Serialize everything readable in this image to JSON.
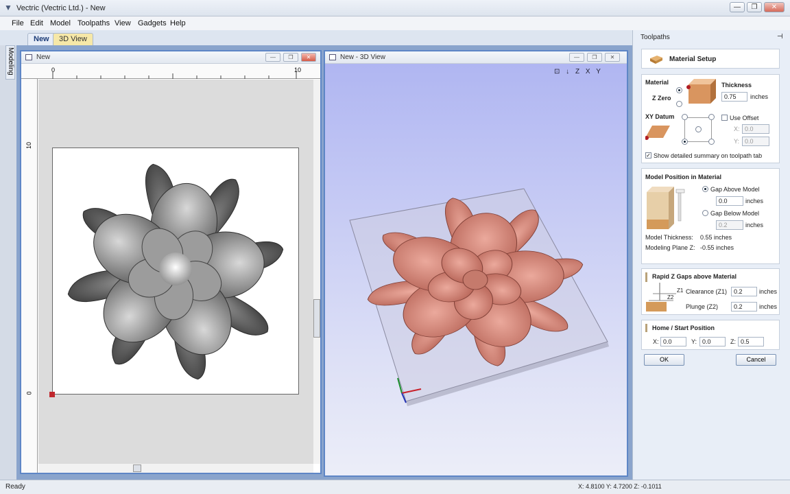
{
  "window": {
    "title": "Vectric (Vectric Ltd.) - New",
    "min": "—",
    "max": "❐",
    "close": "✕"
  },
  "menu": [
    "File",
    "Edit",
    "Model",
    "Toolpaths",
    "View",
    "Gadgets",
    "Help"
  ],
  "tabs": {
    "new": "New",
    "view3d": "3D View",
    "modeling": "Modeling"
  },
  "view2d": {
    "title": "New",
    "ruler_top": [
      "0",
      "10"
    ],
    "ruler_left": [
      "10",
      "0"
    ]
  },
  "view3d": {
    "title": "New - 3D View",
    "view_icons": [
      "⊡",
      "↓",
      "Z",
      "X",
      "Y"
    ]
  },
  "panel": {
    "header": "Toolpaths",
    "pin": "⊣",
    "setup_title": "Material Setup",
    "material": {
      "label": "Material",
      "thickness_label": "Thickness",
      "z_zero": "Z Zero",
      "thickness": "0.75",
      "units": "inches",
      "xy_datum": "XY Datum",
      "use_offset": "Use Offset",
      "x_label": "X:",
      "x": "0.0",
      "y_label": "Y:",
      "y": "0.0",
      "summary": "Show detailed summary on toolpath tab"
    },
    "model_position": {
      "label": "Model Position in Material",
      "gap_above": "Gap Above Model",
      "gap_above_val": "0.0",
      "gap_below": "Gap Below Model",
      "gap_below_val": "0.2",
      "units": "inches",
      "model_thickness_label": "Model Thickness:",
      "model_thickness": "0.55 inches",
      "modeling_plane_label": "Modeling Plane Z:",
      "modeling_plane": "-0.55 inches"
    },
    "rapid": {
      "label": "Rapid Z Gaps above Material",
      "z1": "Z1",
      "z2": "Z2",
      "clearance_label": "Clearance (Z1)",
      "clearance": "0.2",
      "plunge_label": "Plunge (Z2)",
      "plunge": "0.2",
      "units": "inches"
    },
    "home": {
      "label": "Home / Start Position",
      "x_label": "X:",
      "x": "0.0",
      "y_label": "Y:",
      "y": "0.0",
      "z_label": "Z:",
      "z": "0.5"
    },
    "ok": "OK",
    "cancel": "Cancel"
  },
  "status": {
    "left": "Ready",
    "coords": "X: 4.8100 Y: 4.7200 Z: -0.1011"
  },
  "colors": {
    "accent": "#5e86c6",
    "flower3d": "#d9877a",
    "bg3d": "#b6bcf0"
  }
}
